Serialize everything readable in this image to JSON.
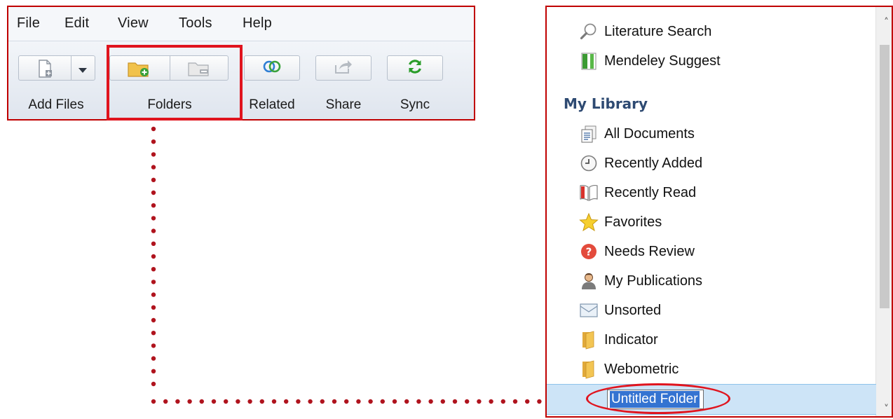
{
  "menu": {
    "items": [
      "File",
      "Edit",
      "View",
      "Tools",
      "Help"
    ]
  },
  "toolbar": {
    "add_files_label": "Add Files",
    "folders_label": "Folders",
    "related_label": "Related",
    "share_label": "Share",
    "sync_label": "Sync"
  },
  "sidebar": {
    "top_items": [
      "Literature Search",
      "Mendeley Suggest"
    ],
    "section_header": "My Library",
    "library_items": [
      "All Documents",
      "Recently Added",
      "Recently Read",
      "Favorites",
      "Needs Review",
      "My Publications",
      "Unsorted",
      "Indicator",
      "Webometric"
    ],
    "new_folder_name": "Untitled Folder"
  },
  "colors": {
    "highlight": "#e0141e",
    "panel_border": "#c00000",
    "dotted_connector": "#b0141e",
    "selection": "#cde4f7",
    "section_header": "#2e4a72",
    "sync_green": "#2a9d2a"
  },
  "icons": {
    "add_file": "document-plus-icon",
    "new_folder": "folder-plus-icon",
    "remove_folder": "folder-minus-icon",
    "related": "overlapping-rings-icon",
    "share": "share-arrow-icon",
    "sync": "sync-arrows-icon"
  }
}
